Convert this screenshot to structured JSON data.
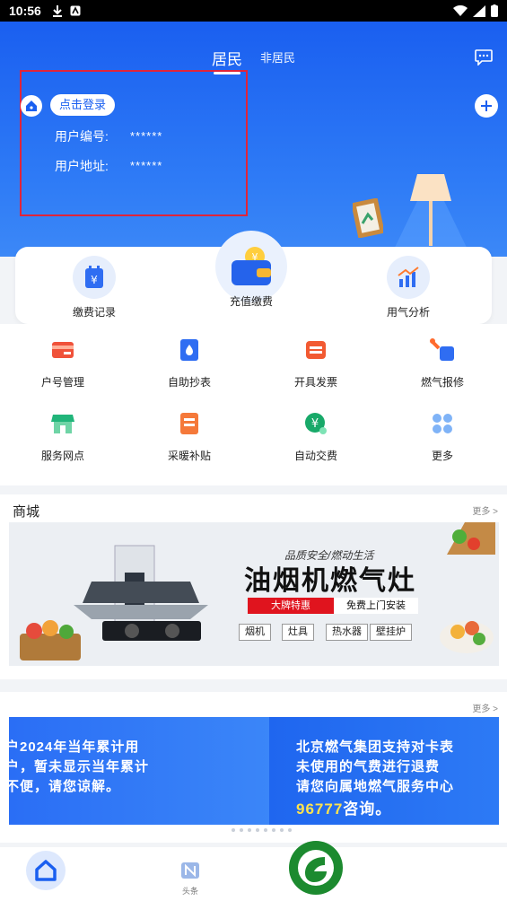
{
  "status_bar": {
    "time": "10:56"
  },
  "header": {
    "tabs": [
      {
        "label": "居民",
        "active": true
      },
      {
        "label": "非居民",
        "active": false
      }
    ],
    "login_button": "点击登录",
    "user_number_label": "用户编号:",
    "user_number_value": "******",
    "user_address_label": "用户地址:",
    "user_address_value": "******"
  },
  "quick_card": {
    "items": [
      {
        "label": "缴费记录",
        "icon": "bill-icon"
      },
      {
        "label": "充值缴费",
        "icon": "wallet-icon"
      },
      {
        "label": "用气分析",
        "icon": "chart-icon"
      }
    ]
  },
  "grid": {
    "items": [
      {
        "label": "户号管理",
        "icon": "card-icon"
      },
      {
        "label": "自助抄表",
        "icon": "meter-icon"
      },
      {
        "label": "开具发票",
        "icon": "invoice-icon"
      },
      {
        "label": "燃气报修",
        "icon": "repair-icon"
      },
      {
        "label": "服务网点",
        "icon": "store-icon"
      },
      {
        "label": "采暖补贴",
        "icon": "subsidy-icon"
      },
      {
        "label": "自动交费",
        "icon": "auto-pay-icon"
      },
      {
        "label": "更多",
        "icon": "more-grid-icon"
      }
    ]
  },
  "mall": {
    "title": "商城",
    "more": "更多 >",
    "banner": {
      "slogan": "品质安全/燃动生活",
      "headline": "油烟机燃气灶",
      "promo_red": "大牌特惠",
      "promo_free": "免费上门安装",
      "products": [
        "烟机",
        "灶具",
        "热水器",
        "壁挂炉"
      ]
    }
  },
  "news": {
    "more": "更多 >",
    "left_lines": [
      "户2024年当年累计用",
      "户，暂未显示当年累计",
      "不便，请您谅解。"
    ],
    "right_lines": [
      "北京燃气集团支持对卡表",
      "未使用的气费进行退费",
      "请您向属地燃气服务中心"
    ],
    "phone": "96777",
    "phone_suffix": "咨询。"
  },
  "bottom_nav": {
    "news_label": "头条"
  },
  "colors": {
    "primary": "#1a5ff0",
    "highlight": "#e0243a",
    "promo_red": "#e0141e"
  }
}
